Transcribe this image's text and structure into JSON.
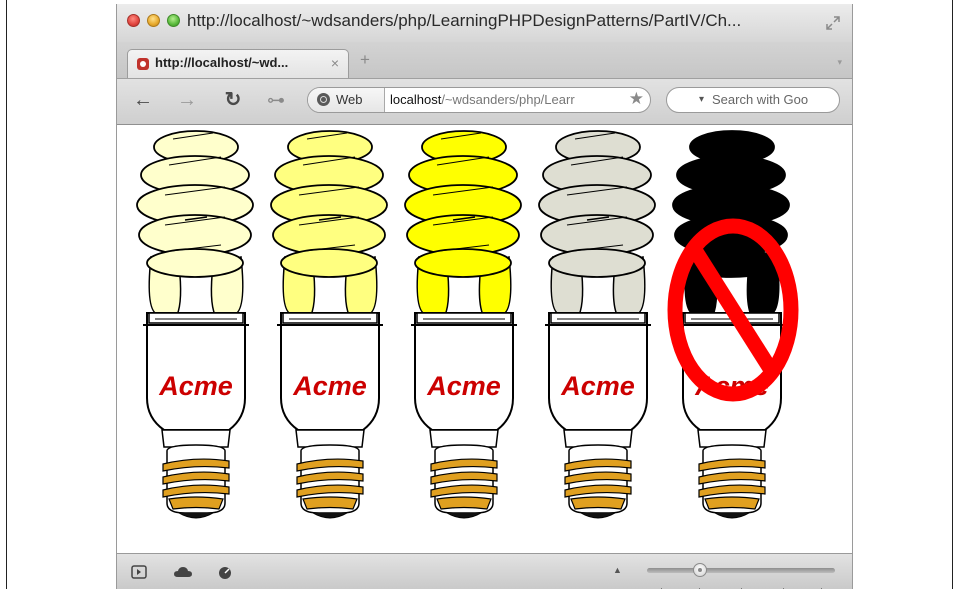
{
  "window": {
    "title": "http://localhost/~wdsanders/php/LearningPHPDesignPatterns/PartIV/Ch..."
  },
  "tab": {
    "label": "http://localhost/~wd...",
    "close_glyph": "×",
    "new_tab_glyph": "+",
    "menu_glyph": "▾"
  },
  "toolbar": {
    "back_glyph": "←",
    "forward_glyph": "→",
    "reload_glyph": "↻",
    "key_glyph": "⊶",
    "web_label": "Web",
    "url_host": "localhost",
    "url_path": "/~wdsanders/php/Learr",
    "bookmark_glyph": "★",
    "search_placeholder": "Search with Goo",
    "search_arrow_glyph": "▾"
  },
  "bulbs": [
    {
      "label": "Acme",
      "color": "#ffffcc",
      "banned": false
    },
    {
      "label": "Acme",
      "color": "#ffff80",
      "banned": false
    },
    {
      "label": "Acme",
      "color": "#ffff00",
      "banned": false
    },
    {
      "label": "Acme",
      "color": "#deded2",
      "banned": false
    },
    {
      "label": "Acme",
      "color": "#000000",
      "banned": true
    }
  ],
  "colors": {
    "brand_text": "#cc0000",
    "ban_sign": "#ff0000",
    "base_gold": "#e0a020"
  },
  "statusbar": {
    "icons": [
      "sidebar-icon",
      "cloud-icon",
      "speedometer-icon"
    ],
    "zoom_up_glyph": "▲",
    "zoom_level": 0.28
  }
}
